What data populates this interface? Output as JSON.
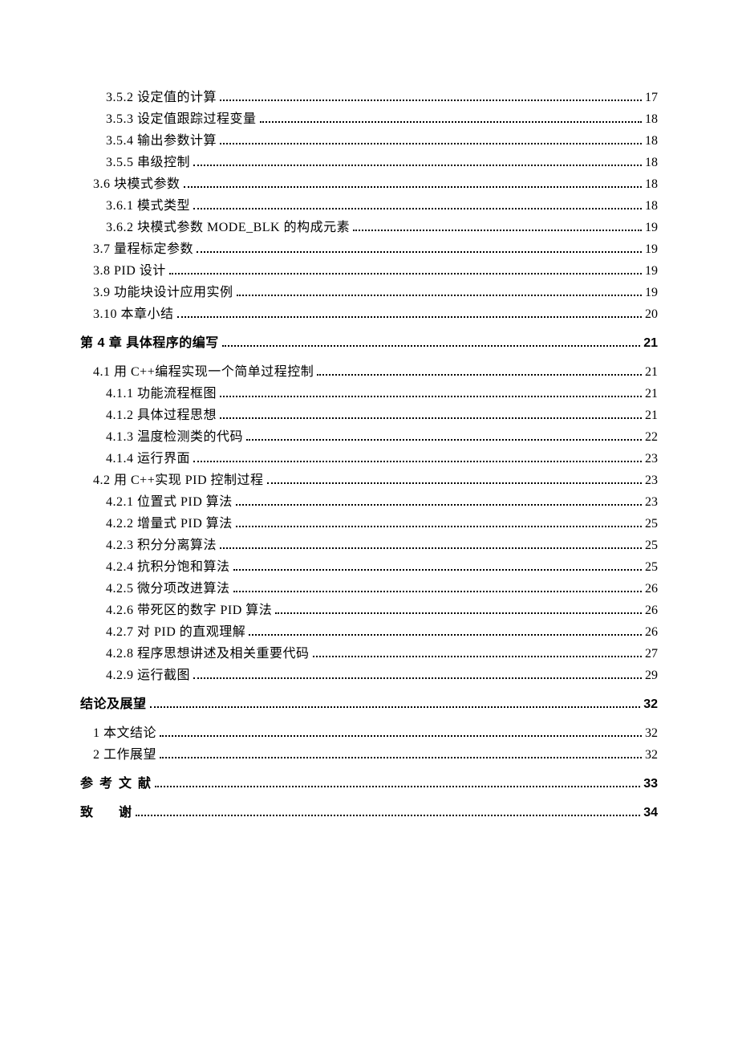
{
  "entries": [
    {
      "indent": 2,
      "label": "3.5.2 设定值的计算",
      "page": "17",
      "class": ""
    },
    {
      "indent": 2,
      "label": "3.5.3 设定值跟踪过程变量",
      "page": "18",
      "class": ""
    },
    {
      "indent": 2,
      "label": "3.5.4 输出参数计算",
      "page": "18",
      "class": ""
    },
    {
      "indent": 2,
      "label": "3.5.5 串级控制",
      "page": "18",
      "class": ""
    },
    {
      "indent": 1,
      "label": "3.6 块模式参数",
      "page": "18",
      "class": ""
    },
    {
      "indent": 2,
      "label": "3.6.1 模式类型",
      "page": "18",
      "class": ""
    },
    {
      "indent": 2,
      "label": "3.6.2 块模式参数 MODE_BLK 的构成元素",
      "page": "19",
      "class": ""
    },
    {
      "indent": 1,
      "label": "3.7 量程标定参数",
      "page": "19",
      "class": ""
    },
    {
      "indent": 1,
      "label": "3.8 PID 设计",
      "page": "19",
      "class": ""
    },
    {
      "indent": 1,
      "label": "3.9 功能块设计应用实例",
      "page": "19",
      "class": ""
    },
    {
      "indent": 1,
      "label": "3.10 本章小结",
      "page": "20",
      "class": ""
    },
    {
      "indent": 0,
      "label": "第 4 章  具体程序的编写",
      "page": "21",
      "class": "bold group-gap"
    },
    {
      "indent": 1,
      "label": "4.1 用 C++编程实现一个简单过程控制",
      "page": "21",
      "class": "group-gap"
    },
    {
      "indent": 2,
      "label": "4.1.1 功能流程框图",
      "page": "21",
      "class": ""
    },
    {
      "indent": 2,
      "label": "4.1.2 具体过程思想",
      "page": "21",
      "class": ""
    },
    {
      "indent": 2,
      "label": "4.1.3 温度检测类的代码",
      "page": "22",
      "class": ""
    },
    {
      "indent": 2,
      "label": "4.1.4 运行界面",
      "page": "23",
      "class": ""
    },
    {
      "indent": 1,
      "label": "4.2 用 C++实现 PID 控制过程",
      "page": "23",
      "class": ""
    },
    {
      "indent": 2,
      "label": "4.2.1 位置式 PID 算法",
      "page": "23",
      "class": ""
    },
    {
      "indent": 2,
      "label": "4.2.2 增量式 PID 算法",
      "page": "25",
      "class": ""
    },
    {
      "indent": 2,
      "label": "4.2.3 积分分离算法",
      "page": "25",
      "class": ""
    },
    {
      "indent": 2,
      "label": "4.2.4 抗积分饱和算法",
      "page": "25",
      "class": ""
    },
    {
      "indent": 2,
      "label": "4.2.5 微分项改进算法",
      "page": "26",
      "class": ""
    },
    {
      "indent": 2,
      "label": "4.2.6 带死区的数字 PID 算法",
      "page": "26",
      "class": ""
    },
    {
      "indent": 2,
      "label": "4.2.7 对 PID 的直观理解",
      "page": "26",
      "class": ""
    },
    {
      "indent": 2,
      "label": "4.2.8 程序思想讲述及相关重要代码",
      "page": "27",
      "class": ""
    },
    {
      "indent": 2,
      "label": "4.2.9 运行截图",
      "page": "29",
      "class": ""
    },
    {
      "indent": 0,
      "label": "结论及展望",
      "page": "32",
      "class": "bold group-gap"
    },
    {
      "indent": 1,
      "label": "1 本文结论",
      "page": "32",
      "class": "group-gap"
    },
    {
      "indent": 1,
      "label": "2 工作展望",
      "page": "32",
      "class": ""
    },
    {
      "indent": 0,
      "label": "参考文献",
      "page": "33",
      "class": "bold group-gap spaced-ref",
      "spaced": true
    },
    {
      "indent": 0,
      "label": "致谢",
      "page": "34",
      "class": "bold group-gap spaced-ack",
      "spaced": true
    }
  ]
}
